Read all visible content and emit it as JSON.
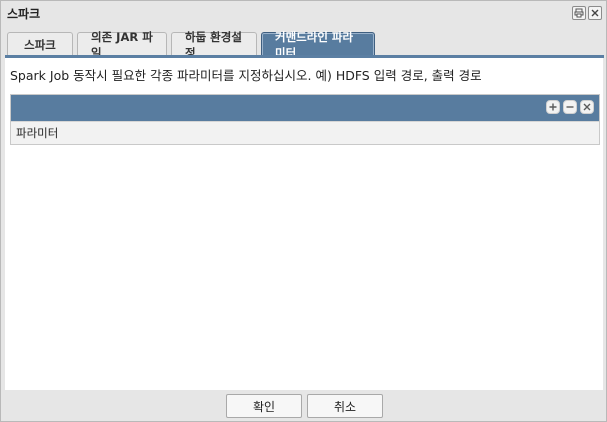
{
  "window": {
    "title": "스파크"
  },
  "tabs": [
    {
      "label": "스파크"
    },
    {
      "label": "의존 JAR 파일"
    },
    {
      "label": "하둡 환경설정"
    },
    {
      "label": "커맨드라인 파라미터",
      "active": true
    }
  ],
  "description": "Spark Job 동작시 필요한 각종 파라미터를 지정하십시오. 예) HDFS 입력 경로, 출력 경로",
  "grid": {
    "column_header": "파라미터",
    "tools": [
      "plus-icon",
      "minus-icon",
      "close-icon"
    ]
  },
  "footer": {
    "ok_label": "확인",
    "cancel_label": "취소"
  },
  "colors": {
    "accent": "#587c9f",
    "background": "#e6e6e6"
  }
}
